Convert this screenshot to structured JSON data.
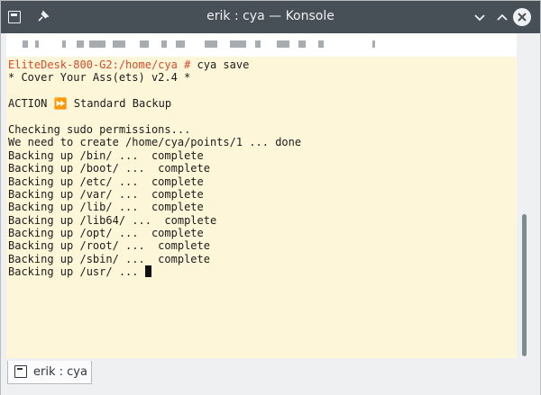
{
  "window": {
    "title": "erik : cya — Konsole"
  },
  "terminal": {
    "prompt_host": "EliteDesk-800-G2:/home/cya #",
    "command": " cya save",
    "lines": [
      "* Cover Your Ass(ets) v2.4 *",
      "",
      "ACTION ⏩ Standard Backup",
      "",
      "Checking sudo permissions...",
      "We need to create /home/cya/points/1 ... done",
      "Backing up /bin/ ...  complete",
      "Backing up /boot/ ...  complete",
      "Backing up /etc/ ...  complete",
      "Backing up /var/ ...  complete",
      "Backing up /lib/ ...  complete",
      "Backing up /lib64/ ...  complete",
      "Backing up /opt/ ...  complete",
      "Backing up /root/ ...  complete",
      "Backing up /sbin/ ...  complete"
    ],
    "current_line": "Backing up /usr/ ... "
  },
  "tabs": [
    {
      "label": "erik : cya"
    }
  ],
  "colors": {
    "titlebar": "#475057",
    "terminal_bg": "#fdf6d8",
    "prompt_host": "#d14d2c",
    "scroll_thumb": "#7f8c8d"
  }
}
